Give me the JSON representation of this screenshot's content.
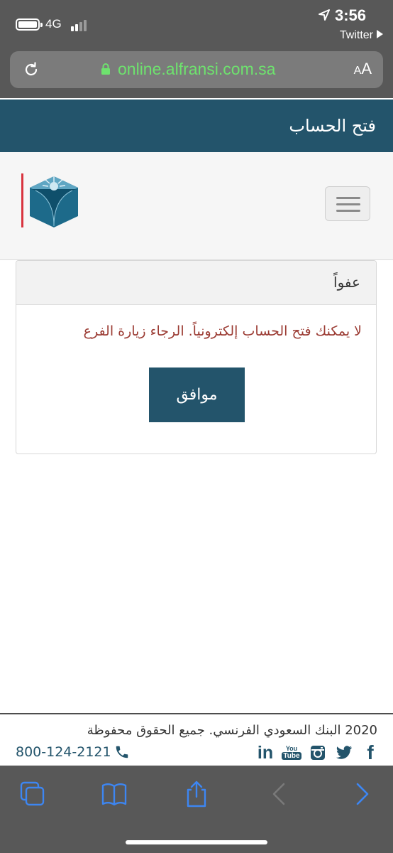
{
  "status_bar": {
    "network": "4G",
    "time": "3:56",
    "back_app": "Twitter"
  },
  "browser": {
    "url": "online.alfransi.com.sa",
    "text_size_label_small": "A",
    "text_size_label_large": "A"
  },
  "header": {
    "title": "فتح الحساب"
  },
  "alert": {
    "title": "عفواً",
    "message": "لا يمكنك فتح الحساب إلكترونياً. الرجاء زيارة الفرع",
    "ok_label": "موافق"
  },
  "footer": {
    "copyright": "2020 البنك السعودي الفرنسي. جميع الحقوق محفوظة",
    "phone": "800-124-2121",
    "social": [
      {
        "name": "linkedin",
        "label": "in"
      },
      {
        "name": "youtube",
        "label_top": "You",
        "label_bottom": "Tube"
      },
      {
        "name": "instagram"
      },
      {
        "name": "twitter"
      },
      {
        "name": "facebook",
        "label": "f"
      }
    ]
  },
  "colors": {
    "brand": "#23546b",
    "error_text": "#9b3b33",
    "url_green": "#6ee26e",
    "browser_chrome": "#585858",
    "toolbar_icon": "#3d86f2"
  }
}
